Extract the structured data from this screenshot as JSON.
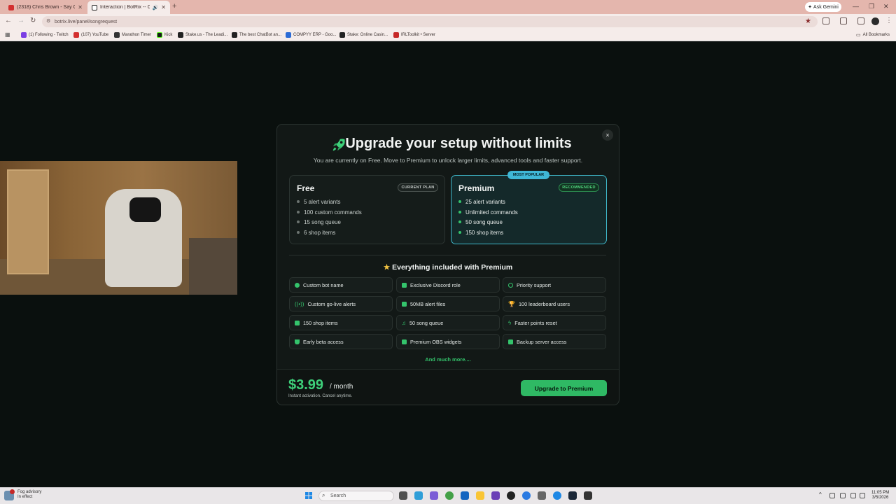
{
  "browser": {
    "tabs": [
      {
        "title": "(2318) Chris Brown - Say Goodb",
        "icon": "youtube-icon",
        "color": "#d32f2f"
      },
      {
        "title": "Interaction | BotRix -- Clou",
        "icon": "botrix-icon",
        "color": "#222222"
      }
    ],
    "ask_gemini": "Ask Gemini",
    "url": "botrix.live/panel/songrequest",
    "bookmarks": [
      {
        "label": "(1) Following - Twitch",
        "color": "#7b3fe4"
      },
      {
        "label": "(107) YouTube",
        "color": "#d32f2f"
      },
      {
        "label": "Marathon Timer",
        "color": "#333333"
      },
      {
        "label": "Kick",
        "color": "#1a1a1a"
      },
      {
        "label": "Stake.us - The Leadi...",
        "color": "#222222"
      },
      {
        "label": "The best ChatBot an...",
        "color": "#222222"
      },
      {
        "label": "COMPYY ERP - Goo...",
        "color": "#2b6bd6"
      },
      {
        "label": "Stake: Online Casin...",
        "color": "#222222"
      },
      {
        "label": "IRLToolkit • Server",
        "color": "#c62828"
      }
    ],
    "all_bookmarks": "All Bookmarks"
  },
  "modal": {
    "title": "Upgrade your setup without limits",
    "subtitle": "You are currently on Free. Move to Premium to unlock larger limits, advanced tools and faster support.",
    "most_popular": "MOST POPULAR",
    "plans": [
      {
        "name": "Free",
        "badge": "CURRENT PLAN",
        "features": [
          "5 alert variants",
          "100 custom commands",
          "15 song queue",
          "6 shop items"
        ]
      },
      {
        "name": "Premium",
        "badge": "RECOMMENDED",
        "features": [
          "25 alert variants",
          "Unlimited commands",
          "50 song queue",
          "150 shop items"
        ]
      }
    ],
    "included_title": "Everything included with Premium",
    "included": [
      "Custom bot name",
      "Exclusive Discord role",
      "Priority support",
      "Custom go-live alerts",
      "50MB alert files",
      "100 leaderboard users",
      "150 shop items",
      "50 song queue",
      "Faster points reset",
      "Early beta access",
      "Premium OBS widgets",
      "Backup server access"
    ],
    "more": "And much more....",
    "price": "$3.99",
    "period": "/ month",
    "price_note": "Instant activation. Cancel anytime.",
    "cta": "Upgrade to Premium",
    "close": "×",
    "colors": {
      "accent": "#34c46c",
      "premium_border": "#3fb7c9"
    }
  },
  "taskbar": {
    "weather_line1": "Fog advisory",
    "weather_line2": "In effect",
    "search": "Search",
    "time": "11:05 PM",
    "date": "3/5/2026"
  }
}
